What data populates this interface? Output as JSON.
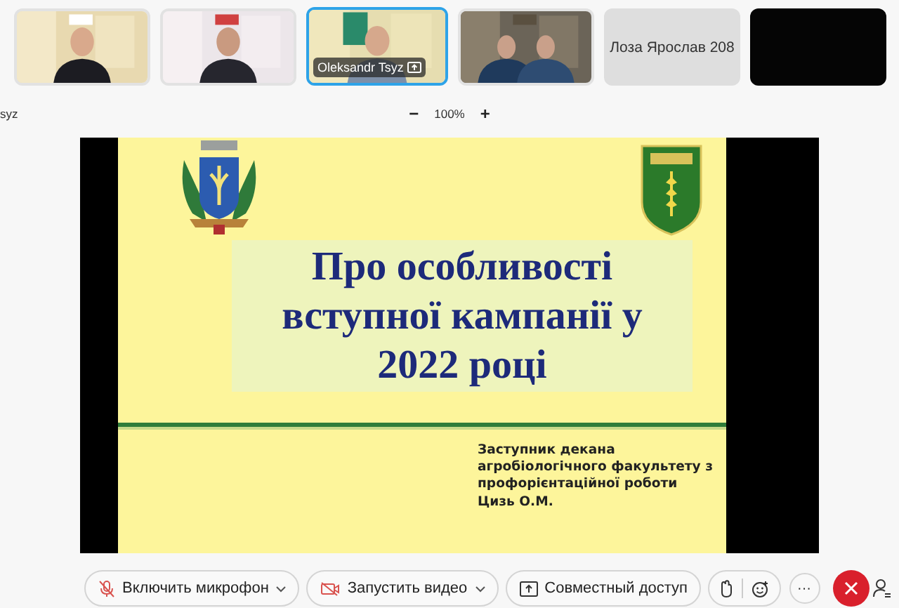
{
  "participants": [
    {
      "kind": "video",
      "selected": false
    },
    {
      "kind": "video",
      "selected": false
    },
    {
      "kind": "video",
      "name": "Oleksandr Tsyz",
      "selected": true
    },
    {
      "kind": "video",
      "selected": false
    },
    {
      "kind": "name",
      "name": "Лоза Ярослав 208",
      "selected": false
    },
    {
      "kind": "blank",
      "selected": false
    }
  ],
  "speaker_label": "syz",
  "zoom": {
    "minus": "−",
    "value": "100%",
    "plus": "+"
  },
  "slide": {
    "title_lines": [
      "Про особливості",
      "вступної кампанії у",
      "2022 році"
    ],
    "subtitle_lines": [
      "Заступник декана",
      "агробіологічного факультету з",
      "профорієнтаційної роботи",
      "Цизь О.М."
    ]
  },
  "toolbar": [
    {
      "kind": "mic",
      "label": "Включить микрофон"
    },
    {
      "kind": "camera",
      "label": "Запустить видео"
    },
    {
      "kind": "share",
      "label": "Совместный доступ"
    },
    {
      "kind": "reactions"
    },
    {
      "kind": "more",
      "label": "···"
    },
    {
      "kind": "end"
    },
    {
      "kind": "people"
    }
  ]
}
